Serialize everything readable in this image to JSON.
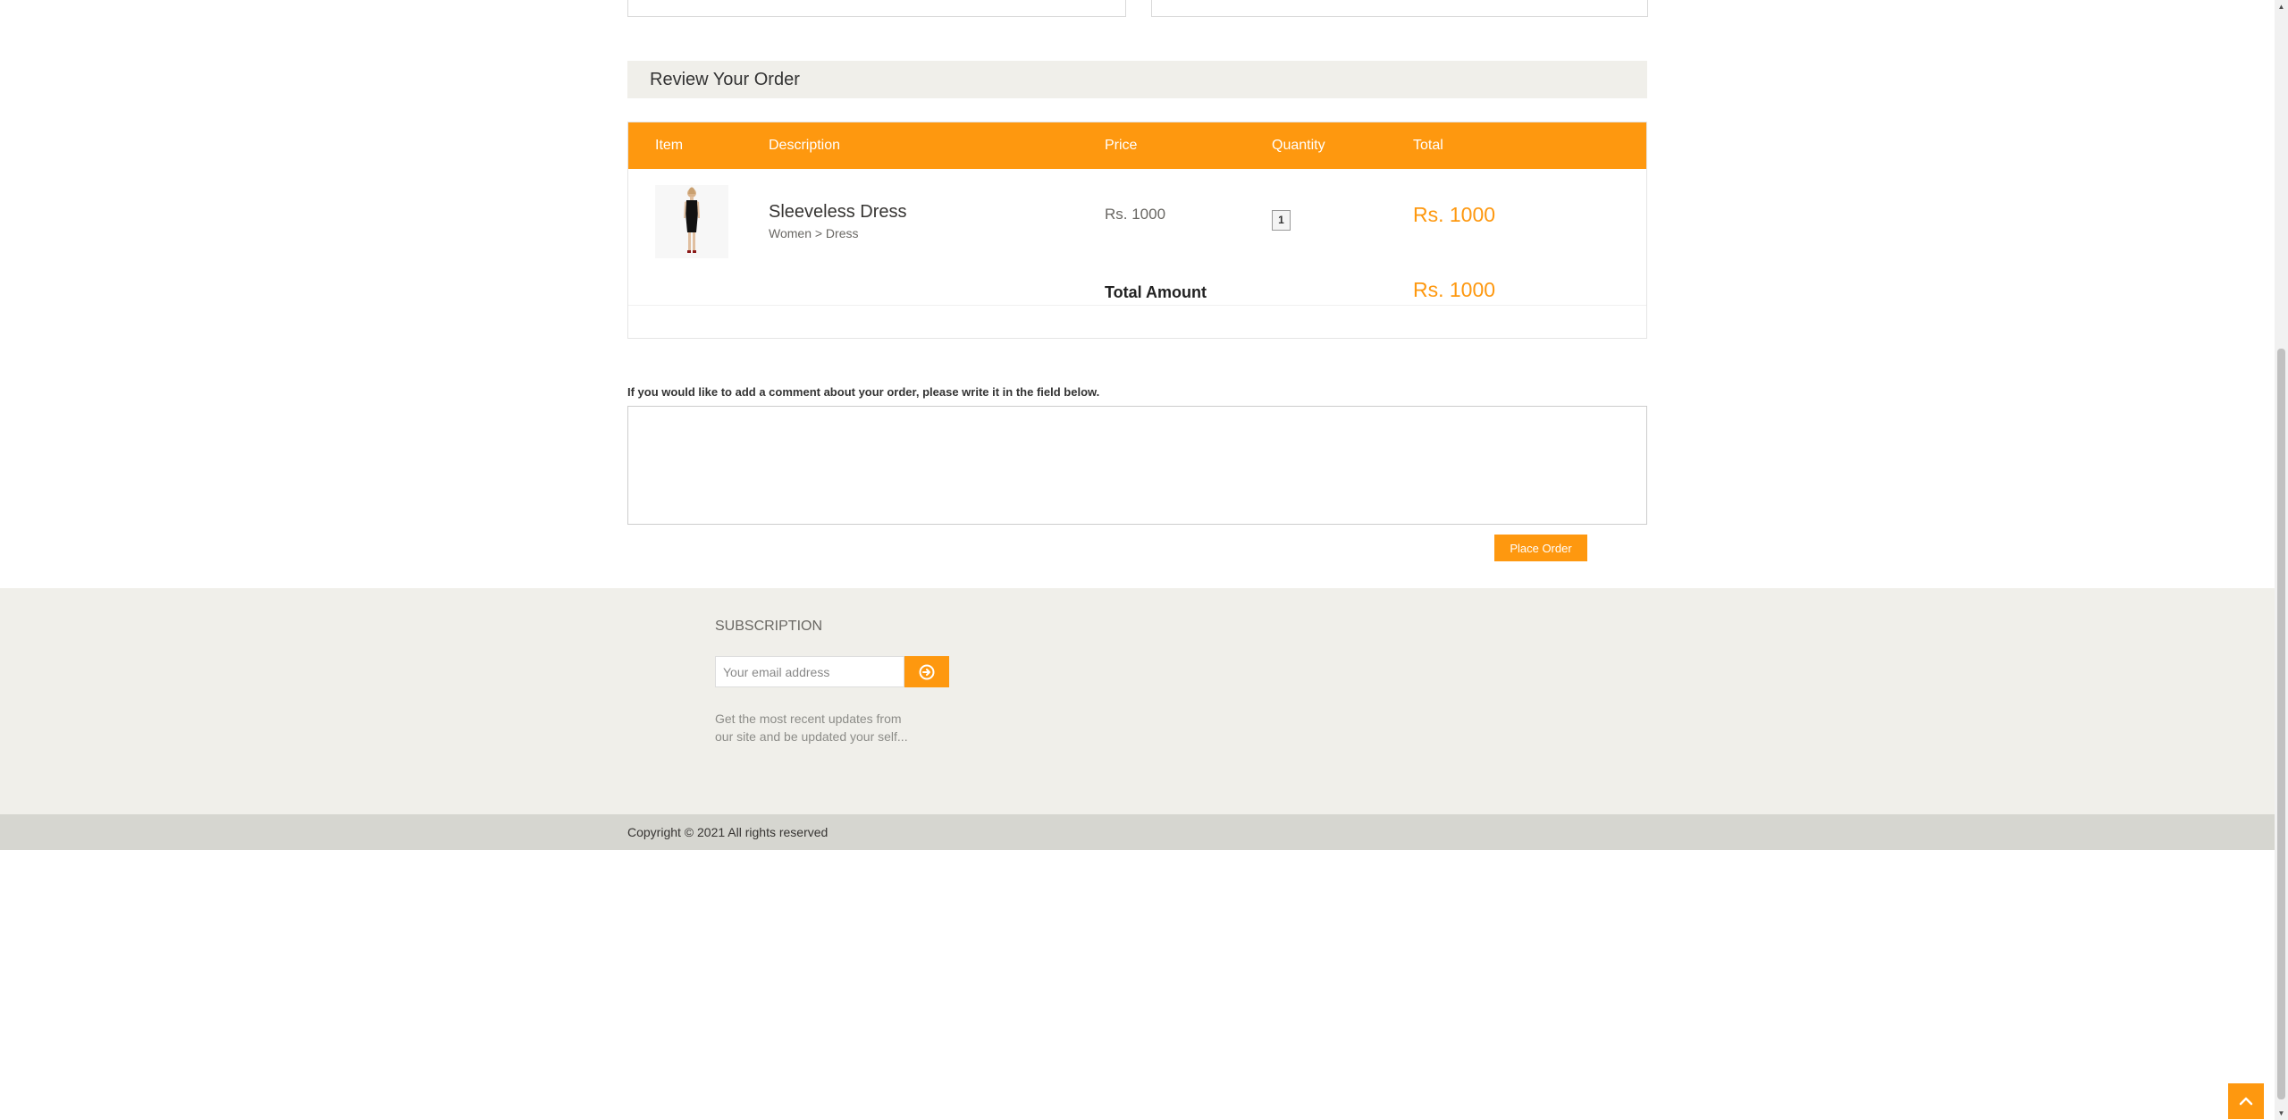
{
  "review": {
    "heading": "Review Your Order",
    "columns": {
      "item": "Item",
      "description": "Description",
      "price": "Price",
      "quantity": "Quantity",
      "total": "Total"
    },
    "product": {
      "name": "Sleeveless Dress",
      "category": "Women > Dress",
      "price": "Rs. 1000",
      "quantity": "1",
      "total": "Rs. 1000"
    },
    "total_label": "Total Amount",
    "total_value": "Rs. 1000"
  },
  "comment": {
    "label": "If you would like to add a comment about your order, please write it in the field below.",
    "value": ""
  },
  "place_order_label": "Place Order",
  "subscription": {
    "title": "SUBSCRIPTION",
    "placeholder": "Your email address",
    "description": "Get the most recent updates from our site and be updated your self..."
  },
  "footer": {
    "copyright": "Copyright © 2021 All rights reserved"
  },
  "icons": {
    "subscribe": "arrow-circle-right-icon",
    "scroll_top": "chevron-up-icon",
    "product_image": "dress-thumbnail"
  },
  "colors": {
    "accent": "#fe980f",
    "panel": "#f0efea",
    "footer_bottom": "#d6d6d0"
  }
}
